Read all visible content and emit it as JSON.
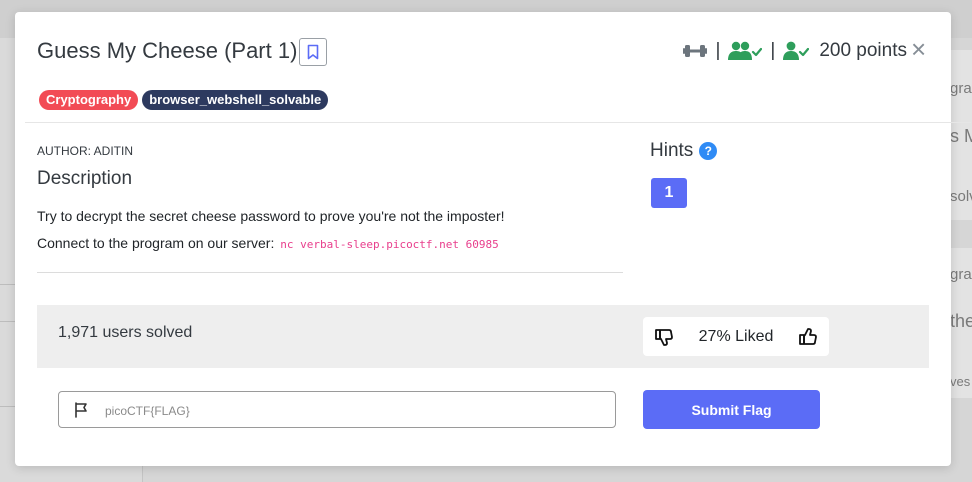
{
  "background": {
    "snippets": [
      "gra",
      "s M",
      "solv",
      "gra",
      "the",
      "ves"
    ]
  },
  "challenge": {
    "title": "Guess My Cheese (Part 1)",
    "points": "200 points",
    "separator": "|",
    "tags": [
      "Cryptography",
      "browser_webshell_solvable"
    ],
    "author": "AUTHOR: ADITIN",
    "description_heading": "Description",
    "description_line1": "Try to decrypt the secret cheese password to prove you're not the imposter!",
    "description_line2_prefix": "Connect to the program on our server:",
    "command": "nc verbal-sleep.picoctf.net 60985"
  },
  "hints": {
    "heading": "Hints",
    "help_symbol": "?",
    "items": [
      "1"
    ]
  },
  "stats": {
    "solved": "1,971 users solved",
    "liked": "27% Liked"
  },
  "flag_form": {
    "placeholder": "picoCTF{FLAG}",
    "submit_label": "Submit Flag"
  },
  "close_symbol": "×",
  "icons": [
    "bookmark-icon",
    "dumbbell-icon",
    "users-check-icon",
    "user-check-icon",
    "close-icon",
    "help-icon",
    "thumbs-down-icon",
    "thumbs-up-icon",
    "flag-icon"
  ],
  "colors": {
    "accent": "#5b6cf6",
    "tag_cryptography": "#f24b55",
    "tag_webshell": "#2d3a5f",
    "success_green": "#2e9e5b",
    "code_pink": "#e83e8c",
    "help_blue": "#2f8bf5"
  }
}
